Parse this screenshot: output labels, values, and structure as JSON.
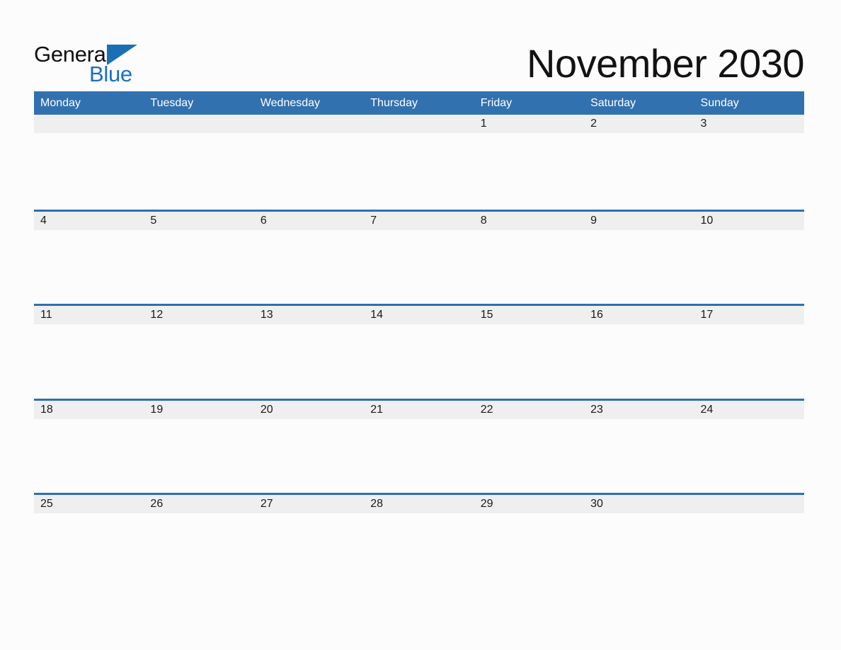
{
  "brand": {
    "name_part1": "General",
    "name_part2": "Blue",
    "triangle_icon": "triangle-logo-icon",
    "accent_color": "#1A6FB5",
    "blue_text_color": "#1B6FC4"
  },
  "header": {
    "title": "November 2030",
    "month": "November",
    "year": "2030"
  },
  "calendar": {
    "header_bg_color": "#3271AF",
    "row_divider_color": "#2E6FB0",
    "day_band_color": "#EFEFEF",
    "cell_bg_color": "#FCFCFD",
    "weekday_headers": [
      "Monday",
      "Tuesday",
      "Wednesday",
      "Thursday",
      "Friday",
      "Saturday",
      "Sunday"
    ],
    "weeks": [
      [
        "",
        "",
        "",
        "",
        "1",
        "2",
        "3"
      ],
      [
        "4",
        "5",
        "6",
        "7",
        "8",
        "9",
        "10"
      ],
      [
        "11",
        "12",
        "13",
        "14",
        "15",
        "16",
        "17"
      ],
      [
        "18",
        "19",
        "20",
        "21",
        "22",
        "23",
        "24"
      ],
      [
        "25",
        "26",
        "27",
        "28",
        "29",
        "30",
        ""
      ]
    ]
  }
}
